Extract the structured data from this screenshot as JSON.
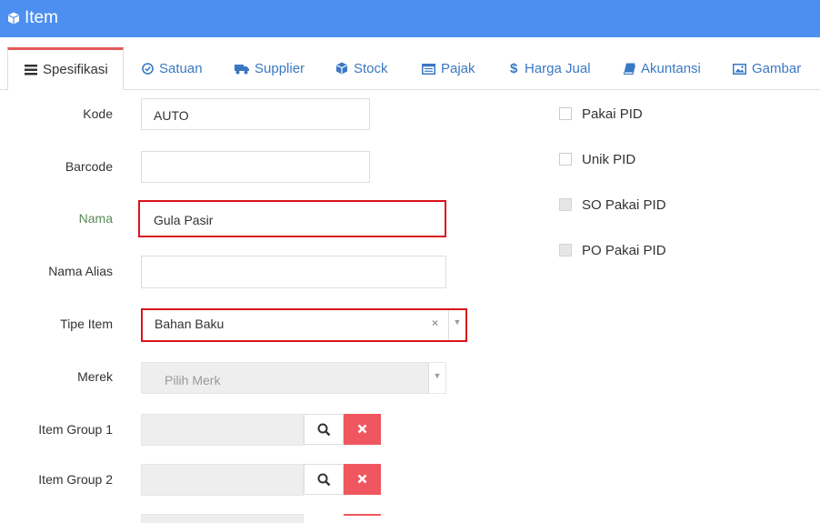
{
  "header": {
    "title": "Item"
  },
  "tabs": [
    {
      "label": "Spesifikasi",
      "icon": "list-icon"
    },
    {
      "label": "Satuan",
      "icon": "check-circle-icon"
    },
    {
      "label": "Supplier",
      "icon": "truck-icon"
    },
    {
      "label": "Stock",
      "icon": "cube-icon"
    },
    {
      "label": "Pajak",
      "icon": "table-icon"
    },
    {
      "label": "Harga Jual",
      "icon": "dollar-icon"
    },
    {
      "label": "Akuntansi",
      "icon": "book-icon"
    },
    {
      "label": "Gambar",
      "icon": "image-icon"
    }
  ],
  "form": {
    "kode": {
      "label": "Kode",
      "value": "AUTO"
    },
    "barcode": {
      "label": "Barcode",
      "value": ""
    },
    "nama": {
      "label": "Nama",
      "value": "Gula Pasir"
    },
    "nama_alias": {
      "label": "Nama Alias",
      "value": ""
    },
    "tipe_item": {
      "label": "Tipe Item",
      "value": "Bahan Baku",
      "clear": "×",
      "arrow": "▼"
    },
    "merek": {
      "label": "Merek",
      "placeholder": "Pilih Merk",
      "arrow": "▼"
    },
    "item_group_1": {
      "label": "Item Group 1",
      "value": ""
    },
    "item_group_2": {
      "label": "Item Group 2",
      "value": ""
    }
  },
  "checks": [
    {
      "label": "Pakai PID",
      "checked": false,
      "disabled": false
    },
    {
      "label": "Unik PID",
      "checked": false,
      "disabled": false
    },
    {
      "label": "SO Pakai PID",
      "checked": false,
      "disabled": true
    },
    {
      "label": "PO Pakai PID",
      "checked": false,
      "disabled": true
    }
  ],
  "colors": {
    "header": "#4c8ff0",
    "tab_text": "#3a78c3",
    "active_tab_border": "#e35a5a",
    "highlight": "#d9141b",
    "clear_button": "#f0565f"
  }
}
